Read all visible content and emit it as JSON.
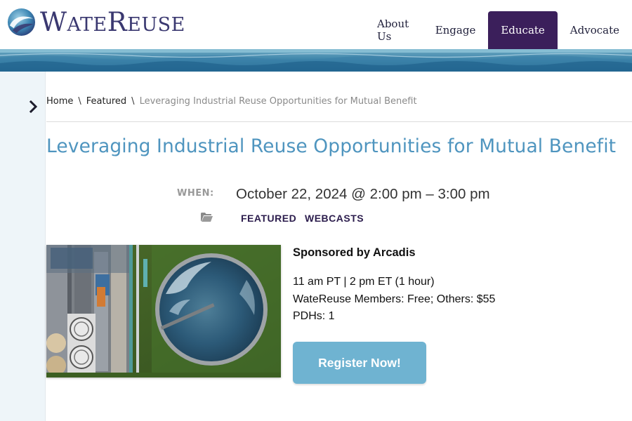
{
  "header": {
    "logo": {
      "prefix_cap": "W",
      "prefix_small": "ATE",
      "suffix_cap": "R",
      "suffix_small": "EUSE"
    },
    "nav": [
      {
        "label": "About Us",
        "active": false
      },
      {
        "label": "Engage",
        "active": false
      },
      {
        "label": "Educate",
        "active": true
      },
      {
        "label": "Advocate",
        "active": false
      }
    ]
  },
  "breadcrumb": {
    "home": "Home",
    "separator": "\\",
    "featured": "Featured",
    "current": "Leveraging Industrial Reuse Opportunities for Mutual Benefit"
  },
  "event": {
    "title": "Leveraging Industrial Reuse Opportunities for Mutual Benefit",
    "when_label": "WHEN:",
    "when_value": "October 22, 2024 @ 2:00 pm – 3:00 pm",
    "categories": [
      "FEATURED",
      "WEBCASTS"
    ],
    "sponsor": "Sponsored by Arcadis",
    "details": [
      "11 am PT | 2 pm ET (1 hour)",
      "WateReuse Members: Free; Others: $55",
      "PDHs: 1"
    ],
    "register_label": "Register Now!"
  },
  "icons": {
    "sidebar_toggle": "chevron-right-icon",
    "category": "folder-icon"
  },
  "colors": {
    "brand_purple": "#3b1f5b",
    "title_blue": "#4f95bf",
    "button_blue": "#6fb3d1",
    "sidebar_bg": "#eef5f9"
  }
}
